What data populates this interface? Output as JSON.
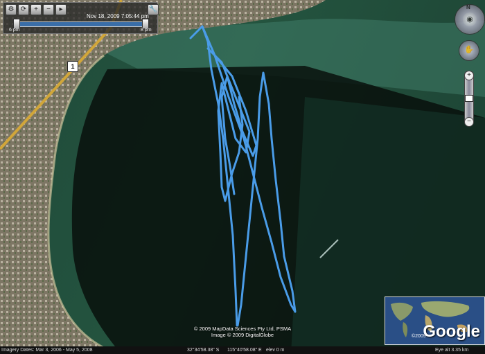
{
  "time_slider": {
    "current": "Nov 18, 2009   7:05:44 pm",
    "start_label": "6 pm",
    "end_label": "8 pm"
  },
  "navigation": {
    "north_label": "N"
  },
  "route_marker": {
    "label": "1"
  },
  "credits": {
    "line1": "© 2009 MapData Sciences Pty Ltd, PSMA",
    "line2": "Image © 2009 DigitalGlobe"
  },
  "inset": {
    "logo": "Google",
    "copyright": "©2009"
  },
  "status_bar": {
    "imagery_dates": "Imagery Dates: Mar 3, 2006 - May 5, 2008",
    "lat": "32°34'58.38\" S",
    "lon": "115°40'58.08\" E",
    "elev": "elev    0 m",
    "eye_alt": "Eye alt    3.35 km"
  },
  "colors": {
    "track": "#4a9ce8",
    "shallow_water": "#2f6a55",
    "deep_water": "#0a120f",
    "land": "#7a7260"
  }
}
